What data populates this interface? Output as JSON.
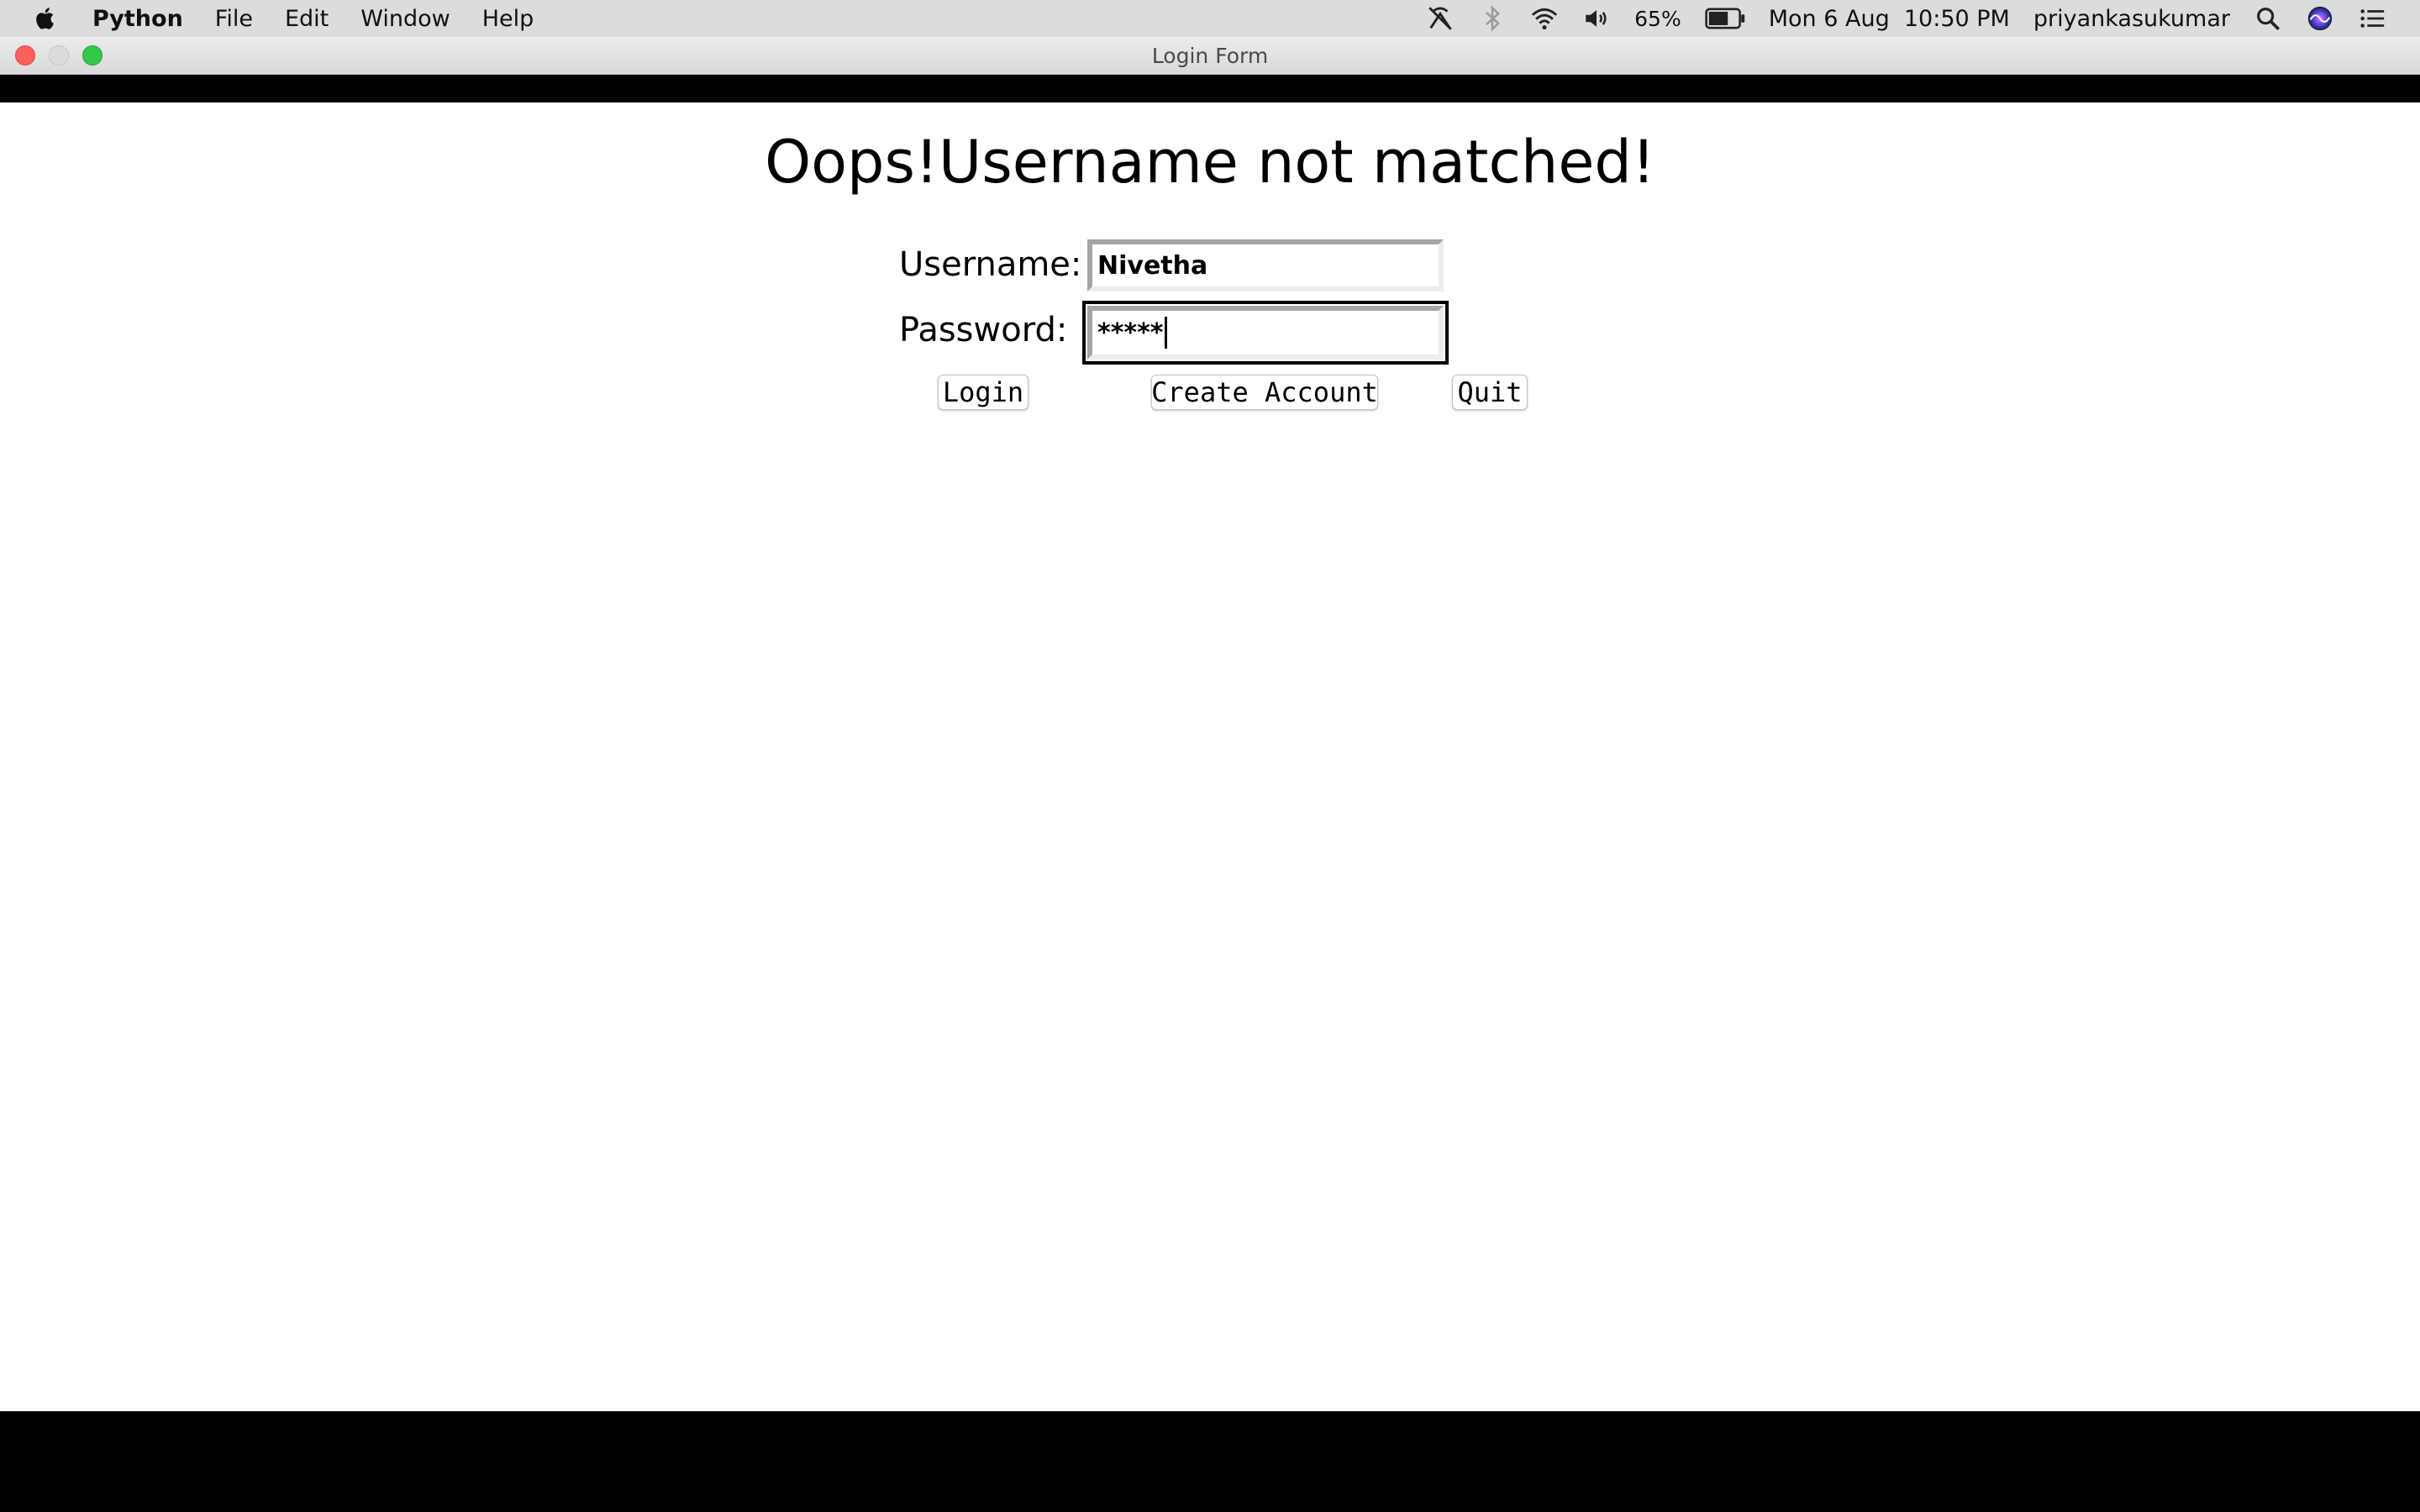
{
  "menubar": {
    "app_name": "Python",
    "items": [
      "File",
      "Edit",
      "Window",
      "Help"
    ],
    "battery_percent": "65%",
    "datetime": "Mon 6 Aug  10:50 PM",
    "user": "priyankasukumar"
  },
  "window": {
    "title": "Login Form"
  },
  "form": {
    "heading": "Oops!Username not matched!",
    "username_label": "Username:",
    "username_value": "Nivetha",
    "password_label": "Password:",
    "password_value": "*****",
    "buttons": {
      "login": "Login",
      "create_account": "Create Account",
      "quit": "Quit"
    }
  },
  "colors": {
    "close": "#fc605c",
    "minimize": "#dcdcdc",
    "zoom": "#34c84a",
    "menubar_bg": "#dcdcdc",
    "content_bg": "#ffffff",
    "frame_bg": "#000000"
  },
  "icons": [
    "apple-icon",
    "airplay-icon",
    "bluetooth-icon",
    "wifi-icon",
    "volume-icon",
    "battery-icon",
    "spotlight-search-icon",
    "siri-icon",
    "notification-center-icon"
  ]
}
